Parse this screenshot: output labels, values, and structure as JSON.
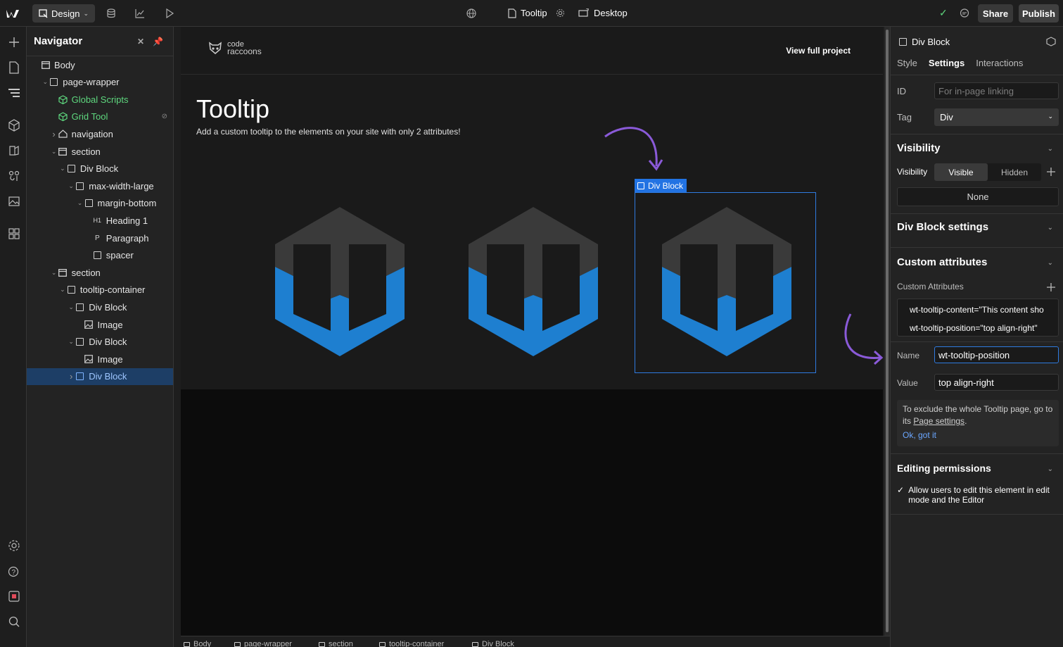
{
  "topbar": {
    "mode_label": "Design",
    "page_name": "Tooltip",
    "device_label": "Desktop",
    "share_label": "Share",
    "publish_label": "Publish"
  },
  "navigator": {
    "title": "Navigator",
    "items": [
      {
        "label": "Body",
        "depth": 0,
        "icon": "body-icon",
        "caret": ""
      },
      {
        "label": "page-wrapper",
        "depth": 1,
        "icon": "box-icon",
        "caret": "down"
      },
      {
        "label": "Global Scripts",
        "depth": 2,
        "icon": "component-icon",
        "caret": "",
        "green": true
      },
      {
        "label": "Grid Tool",
        "depth": 2,
        "icon": "component-icon",
        "caret": "",
        "green": true
      },
      {
        "label": "navigation",
        "depth": 2,
        "icon": "home-icon",
        "caret": "right"
      },
      {
        "label": "section",
        "depth": 2,
        "icon": "section-icon",
        "caret": "down"
      },
      {
        "label": "Div Block",
        "depth": 3,
        "icon": "box-icon",
        "caret": "down"
      },
      {
        "label": "max-width-large",
        "depth": 4,
        "icon": "box-icon",
        "caret": "down"
      },
      {
        "label": "margin-bottom",
        "depth": 5,
        "icon": "box-icon",
        "caret": "down"
      },
      {
        "label": "Heading 1",
        "depth": 6,
        "icon": "heading-icon",
        "caret": ""
      },
      {
        "label": "Paragraph",
        "depth": 6,
        "icon": "paragraph-icon",
        "caret": ""
      },
      {
        "label": "spacer",
        "depth": 6,
        "icon": "box-icon",
        "caret": ""
      },
      {
        "label": "section",
        "depth": 2,
        "icon": "section-icon",
        "caret": "down"
      },
      {
        "label": "tooltip-container",
        "depth": 3,
        "icon": "box-icon",
        "caret": "down"
      },
      {
        "label": "Div Block",
        "depth": 4,
        "icon": "box-icon",
        "caret": "down"
      },
      {
        "label": "Image",
        "depth": 5,
        "icon": "image-icon",
        "caret": ""
      },
      {
        "label": "Div Block",
        "depth": 4,
        "icon": "box-icon",
        "caret": "down"
      },
      {
        "label": "Image",
        "depth": 5,
        "icon": "image-icon",
        "caret": ""
      },
      {
        "label": "Div Block",
        "depth": 4,
        "icon": "box-icon",
        "caret": "right",
        "selected": true
      }
    ]
  },
  "canvas": {
    "brand_line1": "code",
    "brand_line2": "raccoons",
    "view_full_project": "View full project",
    "hero_title": "Tooltip",
    "hero_subtitle": "Add a custom tooltip to the elements on your site with only 2 attributes!",
    "selected_label": "Div Block"
  },
  "breadcrumb": [
    "Body",
    "page-wrapper",
    "section",
    "tooltip-container",
    "Div Block"
  ],
  "panel": {
    "element_name": "Div Block",
    "tabs": [
      "Style",
      "Settings",
      "Interactions"
    ],
    "active_tab": "Settings",
    "id_label": "ID",
    "id_placeholder": "For in-page linking",
    "tag_label": "Tag",
    "tag_value": "Div",
    "visibility_section": "Visibility",
    "visibility_label": "Visibility",
    "visibility_visible": "Visible",
    "visibility_hidden": "Hidden",
    "visibility_none": "None",
    "div_settings_section": "Div Block settings",
    "custom_attributes_section": "Custom attributes",
    "custom_attributes_label": "Custom Attributes",
    "attributes": [
      "wt-tooltip-content=\"This content sho",
      "wt-tooltip-position=\"top align-right\""
    ],
    "name_label": "Name",
    "name_value": "wt-tooltip-position",
    "value_label": "Value",
    "value_value": "top align-right",
    "info_text": "To exclude the whole Tooltip page, go to its",
    "info_link": "Page settings",
    "info_ok": "Ok, got it",
    "editing_section": "Editing permissions",
    "editing_check": "Allow users to edit this element in edit mode and the Editor"
  },
  "colors": {
    "accent": "#2273e3",
    "hex_blue": "#1e7fd0",
    "hex_dark": "#3a3a3a",
    "arrow": "#8a5ad8",
    "green": "#5ed77e"
  }
}
